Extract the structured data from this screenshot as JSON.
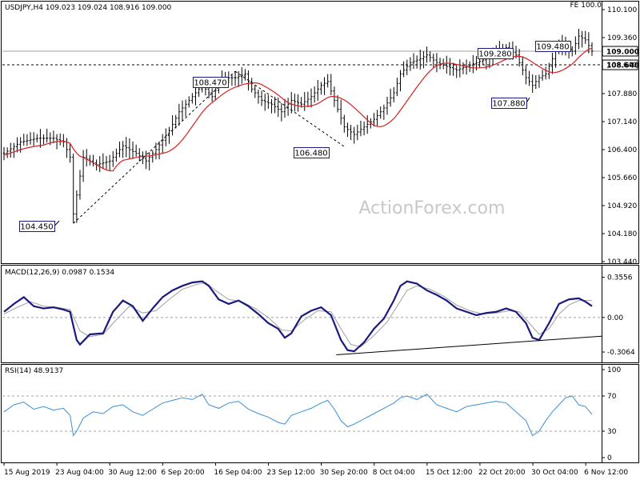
{
  "chart_data": [
    {
      "type": "candlestick",
      "title": "USDJPY,H4  109.023 109.024 108.916 109.000",
      "corner_label": "FE 100.0",
      "watermark": "ActionForex.com",
      "ylim": [
        103.44,
        110.1
      ],
      "y_ticks": [
        "110.100",
        "109.360",
        "108.640",
        "107.880",
        "107.140",
        "106.400",
        "105.660",
        "104.920",
        "104.180",
        "103.440"
      ],
      "y_tick_values": [
        110.1,
        109.36,
        108.64,
        107.88,
        107.14,
        106.4,
        105.66,
        104.92,
        104.18,
        103.44
      ],
      "current_price": {
        "label": "109.000",
        "value": 109.0
      },
      "level_line": {
        "label": "108.640",
        "value": 108.64
      },
      "price_anchors": [
        [
          0,
          106.3
        ],
        [
          5,
          106.6
        ],
        [
          10,
          106.7
        ],
        [
          15,
          106.7
        ],
        [
          18,
          106.6
        ],
        [
          20,
          106.2
        ],
        [
          21,
          104.7
        ],
        [
          24,
          106.2
        ],
        [
          28,
          106.0
        ],
        [
          32,
          106.1
        ],
        [
          36,
          106.5
        ],
        [
          40,
          106.3
        ],
        [
          43,
          106.1
        ],
        [
          46,
          106.4
        ],
        [
          50,
          106.9
        ],
        [
          53,
          107.4
        ],
        [
          57,
          107.8
        ],
        [
          60,
          108.1
        ],
        [
          63,
          107.8
        ],
        [
          66,
          108.3
        ],
        [
          70,
          108.3
        ],
        [
          73,
          108.4
        ],
        [
          75,
          108.0
        ],
        [
          78,
          107.7
        ],
        [
          81,
          107.6
        ],
        [
          84,
          107.4
        ],
        [
          87,
          107.7
        ],
        [
          90,
          107.6
        ],
        [
          93,
          107.8
        ],
        [
          96,
          108.1
        ],
        [
          98,
          108.2
        ],
        [
          100,
          107.7
        ],
        [
          103,
          107.0
        ],
        [
          106,
          106.8
        ],
        [
          109,
          107.0
        ],
        [
          112,
          107.2
        ],
        [
          115,
          107.5
        ],
        [
          118,
          107.9
        ],
        [
          120,
          108.4
        ],
        [
          123,
          108.7
        ],
        [
          126,
          108.8
        ],
        [
          128,
          108.9
        ],
        [
          131,
          108.7
        ],
        [
          134,
          108.6
        ],
        [
          137,
          108.5
        ],
        [
          140,
          108.6
        ],
        [
          143,
          108.7
        ],
        [
          146,
          108.8
        ],
        [
          149,
          109.0
        ],
        [
          152,
          109.1
        ],
        [
          155,
          108.9
        ],
        [
          158,
          108.3
        ],
        [
          160,
          108.1
        ],
        [
          162,
          108.3
        ],
        [
          164,
          108.4
        ],
        [
          166,
          108.8
        ],
        [
          168,
          109.2
        ],
        [
          170,
          109.1
        ],
        [
          172,
          109.0
        ],
        [
          174,
          109.4
        ],
        [
          176,
          109.3
        ],
        [
          178,
          109.0
        ]
      ],
      "ma_line": {
        "color": "#d82020",
        "label": "moving average"
      },
      "annotations": [
        {
          "label": "108.470",
          "value": 108.47
        },
        {
          "label": "104.450",
          "value": 104.45
        },
        {
          "label": "106.480",
          "value": 106.48
        },
        {
          "label": "109.280",
          "value": 109.28
        },
        {
          "label": "107.880",
          "value": 107.88
        },
        {
          "label": "109.480",
          "value": 109.48
        }
      ],
      "trend_lines": [
        {
          "from": [
            21,
            104.45
          ],
          "to": [
            70,
            108.47
          ]
        },
        {
          "from": [
            70,
            108.47
          ],
          "to": [
            103,
            106.48
          ]
        }
      ]
    },
    {
      "type": "line",
      "title": "MACD(12,26,9) 0.0987 0.1534",
      "ylim": [
        -0.37,
        0.41
      ],
      "y_ticks": [
        "0.3556",
        "0.00",
        "-0.3064"
      ],
      "y_tick_values": [
        0.3556,
        0.0,
        -0.3064
      ],
      "series": [
        {
          "color": "#1a1a80",
          "points": [
            [
              0,
              0.05
            ],
            [
              3,
              0.12
            ],
            [
              6,
              0.18
            ],
            [
              9,
              0.1
            ],
            [
              12,
              0.08
            ],
            [
              15,
              0.09
            ],
            [
              18,
              0.07
            ],
            [
              20,
              0.05
            ],
            [
              22,
              -0.2
            ],
            [
              23,
              -0.24
            ],
            [
              26,
              -0.15
            ],
            [
              30,
              -0.14
            ],
            [
              33,
              0.05
            ],
            [
              36,
              0.15
            ],
            [
              39,
              0.1
            ],
            [
              42,
              -0.03
            ],
            [
              45,
              0.08
            ],
            [
              48,
              0.18
            ],
            [
              51,
              0.24
            ],
            [
              54,
              0.28
            ],
            [
              57,
              0.31
            ],
            [
              60,
              0.32
            ],
            [
              62,
              0.28
            ],
            [
              65,
              0.16
            ],
            [
              68,
              0.12
            ],
            [
              71,
              0.15
            ],
            [
              74,
              0.1
            ],
            [
              77,
              0.03
            ],
            [
              80,
              -0.05
            ],
            [
              83,
              -0.1
            ],
            [
              85,
              -0.18
            ],
            [
              87,
              -0.14
            ],
            [
              90,
              0.01
            ],
            [
              93,
              0.06
            ],
            [
              96,
              0.09
            ],
            [
              99,
              0.02
            ],
            [
              102,
              -0.2
            ],
            [
              104,
              -0.29
            ],
            [
              106,
              -0.3
            ],
            [
              109,
              -0.22
            ],
            [
              112,
              -0.1
            ],
            [
              115,
              -0.01
            ],
            [
              118,
              0.15
            ],
            [
              120,
              0.28
            ],
            [
              122,
              0.32
            ],
            [
              125,
              0.3
            ],
            [
              128,
              0.24
            ],
            [
              131,
              0.2
            ],
            [
              134,
              0.15
            ],
            [
              137,
              0.08
            ],
            [
              140,
              0.05
            ],
            [
              143,
              0.02
            ],
            [
              146,
              0.04
            ],
            [
              149,
              0.05
            ],
            [
              152,
              0.08
            ],
            [
              155,
              0.05
            ],
            [
              158,
              -0.05
            ],
            [
              160,
              -0.18
            ],
            [
              162,
              -0.2
            ],
            [
              165,
              -0.05
            ],
            [
              168,
              0.12
            ],
            [
              171,
              0.16
            ],
            [
              174,
              0.17
            ],
            [
              176,
              0.14
            ],
            [
              178,
              0.1
            ]
          ]
        },
        {
          "color": "#a0a0a0",
          "points": [
            [
              0,
              0.03
            ],
            [
              4,
              0.09
            ],
            [
              8,
              0.14
            ],
            [
              12,
              0.1
            ],
            [
              16,
              0.09
            ],
            [
              20,
              0.07
            ],
            [
              23,
              -0.12
            ],
            [
              26,
              -0.17
            ],
            [
              30,
              -0.15
            ],
            [
              34,
              -0.02
            ],
            [
              38,
              0.1
            ],
            [
              42,
              0.04
            ],
            [
              46,
              0.06
            ],
            [
              50,
              0.16
            ],
            [
              54,
              0.25
            ],
            [
              58,
              0.29
            ],
            [
              61,
              0.31
            ],
            [
              64,
              0.24
            ],
            [
              68,
              0.16
            ],
            [
              72,
              0.14
            ],
            [
              76,
              0.08
            ],
            [
              80,
              0.0
            ],
            [
              84,
              -0.11
            ],
            [
              87,
              -0.12
            ],
            [
              91,
              -0.02
            ],
            [
              95,
              0.06
            ],
            [
              99,
              0.05
            ],
            [
              102,
              -0.1
            ],
            [
              105,
              -0.24
            ],
            [
              108,
              -0.26
            ],
            [
              112,
              -0.16
            ],
            [
              116,
              -0.04
            ],
            [
              119,
              0.1
            ],
            [
              122,
              0.24
            ],
            [
              125,
              0.28
            ],
            [
              129,
              0.25
            ],
            [
              133,
              0.19
            ],
            [
              137,
              0.11
            ],
            [
              141,
              0.06
            ],
            [
              145,
              0.03
            ],
            [
              149,
              0.04
            ],
            [
              153,
              0.06
            ],
            [
              156,
              0.05
            ],
            [
              159,
              -0.05
            ],
            [
              162,
              -0.15
            ],
            [
              165,
              -0.1
            ],
            [
              168,
              0.03
            ],
            [
              171,
              0.11
            ],
            [
              174,
              0.15
            ],
            [
              178,
              0.15
            ]
          ]
        }
      ],
      "trend_line": {
        "from": [
          103,
          -0.31
        ],
        "to": [
          178,
          -0.18
        ]
      }
    },
    {
      "type": "line",
      "title": "RSI(14) 48.9137",
      "ylim": [
        0,
        100
      ],
      "y_ticks": [
        "100",
        "70",
        "30",
        "0"
      ],
      "y_tick_values": [
        100,
        70,
        30,
        0
      ],
      "series": [
        {
          "color": "#3a8ed8",
          "points": [
            [
              0,
              52
            ],
            [
              3,
              60
            ],
            [
              6,
              63
            ],
            [
              9,
              55
            ],
            [
              12,
              58
            ],
            [
              15,
              54
            ],
            [
              18,
              56
            ],
            [
              20,
              48
            ],
            [
              21,
              25
            ],
            [
              22,
              30
            ],
            [
              24,
              45
            ],
            [
              27,
              52
            ],
            [
              30,
              50
            ],
            [
              33,
              58
            ],
            [
              36,
              60
            ],
            [
              39,
              52
            ],
            [
              42,
              48
            ],
            [
              45,
              55
            ],
            [
              48,
              62
            ],
            [
              51,
              65
            ],
            [
              54,
              68
            ],
            [
              57,
              66
            ],
            [
              60,
              72
            ],
            [
              62,
              60
            ],
            [
              65,
              56
            ],
            [
              68,
              62
            ],
            [
              71,
              64
            ],
            [
              74,
              55
            ],
            [
              77,
              50
            ],
            [
              80,
              46
            ],
            [
              83,
              40
            ],
            [
              85,
              38
            ],
            [
              87,
              48
            ],
            [
              90,
              52
            ],
            [
              93,
              56
            ],
            [
              96,
              62
            ],
            [
              98,
              65
            ],
            [
              100,
              55
            ],
            [
              102,
              42
            ],
            [
              104,
              35
            ],
            [
              106,
              38
            ],
            [
              109,
              44
            ],
            [
              112,
              50
            ],
            [
              115,
              56
            ],
            [
              118,
              62
            ],
            [
              120,
              68
            ],
            [
              122,
              70
            ],
            [
              125,
              66
            ],
            [
              128,
              72
            ],
            [
              131,
              60
            ],
            [
              134,
              56
            ],
            [
              137,
              52
            ],
            [
              140,
              58
            ],
            [
              143,
              60
            ],
            [
              146,
              62
            ],
            [
              149,
              64
            ],
            [
              152,
              62
            ],
            [
              155,
              52
            ],
            [
              158,
              42
            ],
            [
              160,
              25
            ],
            [
              162,
              30
            ],
            [
              164,
              42
            ],
            [
              166,
              52
            ],
            [
              168,
              60
            ],
            [
              170,
              68
            ],
            [
              172,
              70
            ],
            [
              174,
              60
            ],
            [
              176,
              58
            ],
            [
              178,
              49
            ]
          ]
        }
      ],
      "levels": [
        70,
        30
      ]
    }
  ],
  "x_axis_labels": [
    "15 Aug 2019",
    "23 Aug 04:00",
    "30 Aug 12:00",
    "6 Sep 20:00",
    "16 Sep 04:00",
    "23 Sep 12:00",
    "30 Sep 20:00",
    "8 Oct 04:00",
    "15 Oct 12:00",
    "22 Oct 20:00",
    "30 Oct 04:00",
    "6 Nov 12:00"
  ],
  "x_axis_label_index": [
    0,
    21,
    42,
    63,
    84,
    105,
    126,
    147,
    168,
    189,
    210,
    231
  ]
}
